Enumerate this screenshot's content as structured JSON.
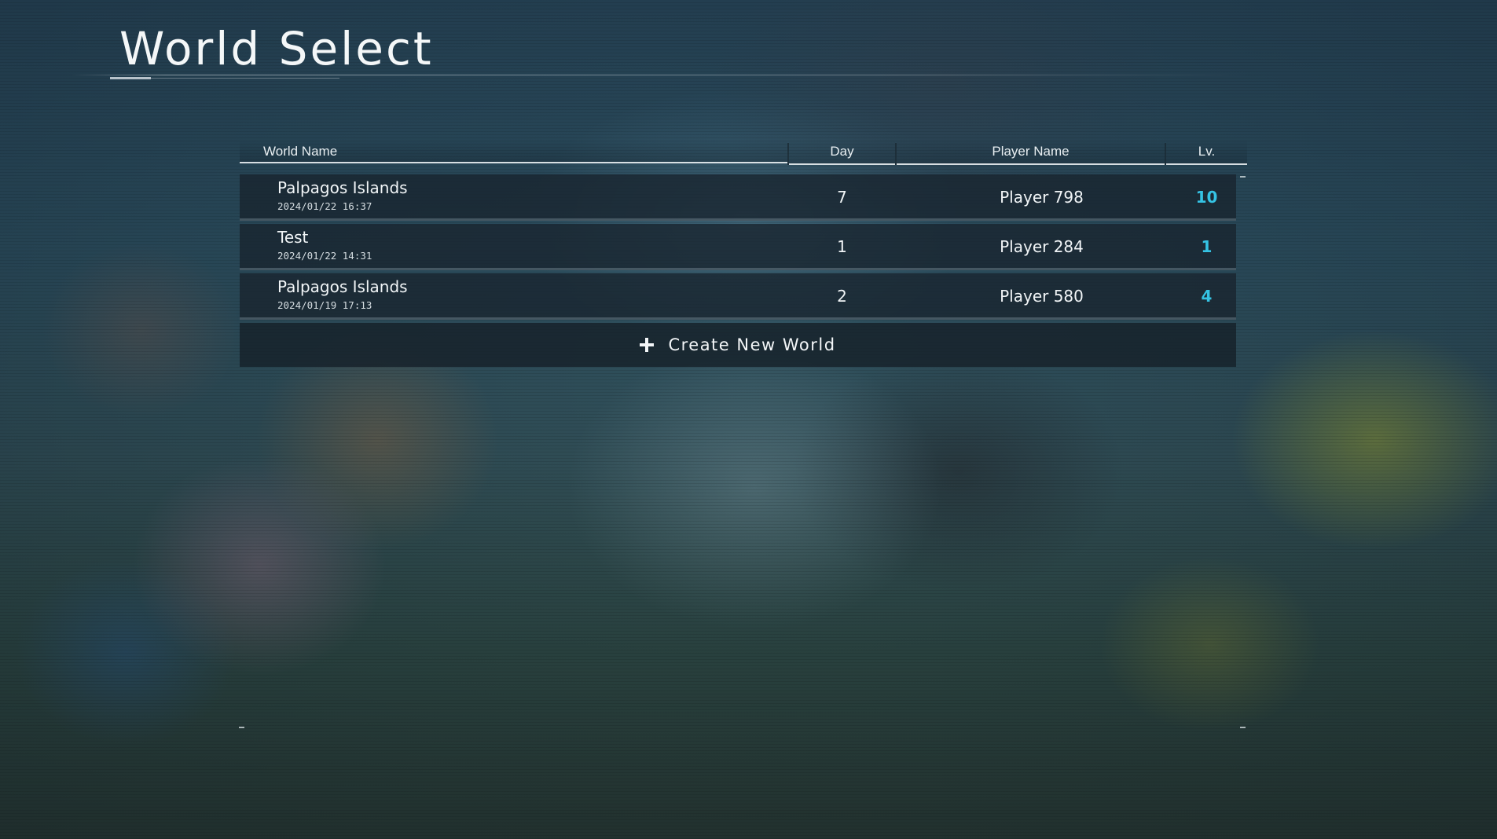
{
  "screen": {
    "title": "World Select"
  },
  "table": {
    "columns": {
      "world_name": "World Name",
      "day": "Day",
      "player_name": "Player Name",
      "level": "Lv."
    },
    "rows": [
      {
        "world_name": "Palpagos Islands",
        "date": "2024/01/22  16:37",
        "day": "7",
        "player_name": "Player 798",
        "level": "10"
      },
      {
        "world_name": "Test",
        "date": "2024/01/22  14:31",
        "day": "1",
        "player_name": "Player 284",
        "level": "1"
      },
      {
        "world_name": "Palpagos Islands",
        "date": "2024/01/19  17:13",
        "day": "2",
        "player_name": "Player 580",
        "level": "4"
      }
    ]
  },
  "create_button": {
    "label": "Create New World",
    "icon": "plus-icon"
  },
  "colors": {
    "level_accent": "#35c3e4",
    "row_background": "#18242e"
  }
}
